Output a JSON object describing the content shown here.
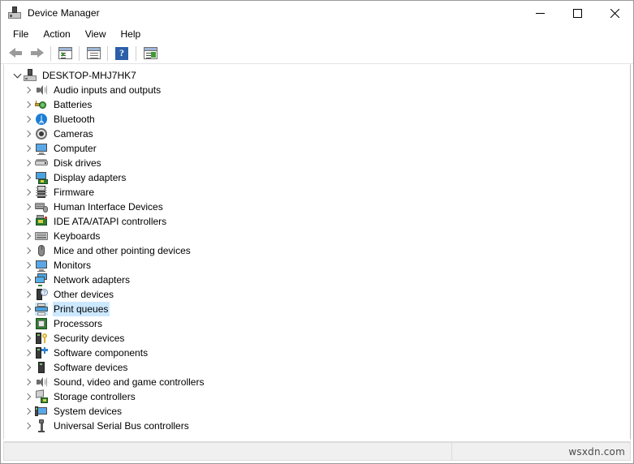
{
  "window": {
    "title": "Device Manager",
    "title_icon": "device-manager-icon",
    "controls": {
      "minimize": "minimize-icon",
      "maximize": "maximize-icon",
      "close": "close-icon"
    }
  },
  "menubar": {
    "items": [
      {
        "label": "File"
      },
      {
        "label": "Action"
      },
      {
        "label": "View"
      },
      {
        "label": "Help"
      }
    ]
  },
  "toolbar": {
    "buttons": [
      {
        "name": "back-button",
        "icon": "arrow-left-icon"
      },
      {
        "name": "forward-button",
        "icon": "arrow-right-icon"
      },
      {
        "name": "properties-button",
        "icon": "properties-window-icon"
      },
      {
        "name": "show-hidden-devices-button",
        "icon": "list-window-icon"
      },
      {
        "name": "help-button",
        "icon": "help-question-icon",
        "glyph": "?"
      },
      {
        "name": "scan-hardware-changes-button",
        "icon": "scan-window-icon"
      }
    ]
  },
  "tree": {
    "root": {
      "label": "DESKTOP-MHJ7HK7",
      "icon": "computer-icon",
      "expanded": true
    },
    "items": [
      {
        "label": "Audio inputs and outputs",
        "icon": "speaker-icon",
        "selected": false
      },
      {
        "label": "Batteries",
        "icon": "battery-icon",
        "selected": false
      },
      {
        "label": "Bluetooth",
        "icon": "bluetooth-icon",
        "selected": false
      },
      {
        "label": "Cameras",
        "icon": "camera-icon",
        "selected": false
      },
      {
        "label": "Computer",
        "icon": "monitor-icon",
        "selected": false
      },
      {
        "label": "Disk drives",
        "icon": "disk-drive-icon",
        "selected": false
      },
      {
        "label": "Display adapters",
        "icon": "display-adapter-icon",
        "selected": false
      },
      {
        "label": "Firmware",
        "icon": "firmware-icon",
        "selected": false
      },
      {
        "label": "Human Interface Devices",
        "icon": "human-interface-device-icon",
        "selected": false
      },
      {
        "label": "IDE ATA/ATAPI controllers",
        "icon": "ide-controller-icon",
        "selected": false
      },
      {
        "label": "Keyboards",
        "icon": "keyboard-icon",
        "selected": false
      },
      {
        "label": "Mice and other pointing devices",
        "icon": "mouse-icon",
        "selected": false
      },
      {
        "label": "Monitors",
        "icon": "monitor-icon",
        "selected": false
      },
      {
        "label": "Network adapters",
        "icon": "network-adapter-icon",
        "selected": false
      },
      {
        "label": "Other devices",
        "icon": "unknown-device-icon",
        "selected": false
      },
      {
        "label": "Print queues",
        "icon": "printer-icon",
        "selected": true
      },
      {
        "label": "Processors",
        "icon": "processor-icon",
        "selected": false
      },
      {
        "label": "Security devices",
        "icon": "security-device-icon",
        "selected": false
      },
      {
        "label": "Software components",
        "icon": "software-component-icon",
        "selected": false
      },
      {
        "label": "Software devices",
        "icon": "software-device-icon",
        "selected": false
      },
      {
        "label": "Sound, video and game controllers",
        "icon": "speaker-icon",
        "selected": false
      },
      {
        "label": "Storage controllers",
        "icon": "storage-controller-icon",
        "selected": false
      },
      {
        "label": "System devices",
        "icon": "system-device-icon",
        "selected": false
      },
      {
        "label": "Universal Serial Bus controllers",
        "icon": "usb-icon",
        "selected": false
      }
    ]
  },
  "statusbar": {
    "message": "",
    "watermark": "wsxdn.com"
  },
  "colors": {
    "selection": "#cce8ff",
    "help_button": "#2b5faa",
    "window_bg": "#ffffff",
    "statusbar_bg": "#f0f0f0"
  }
}
